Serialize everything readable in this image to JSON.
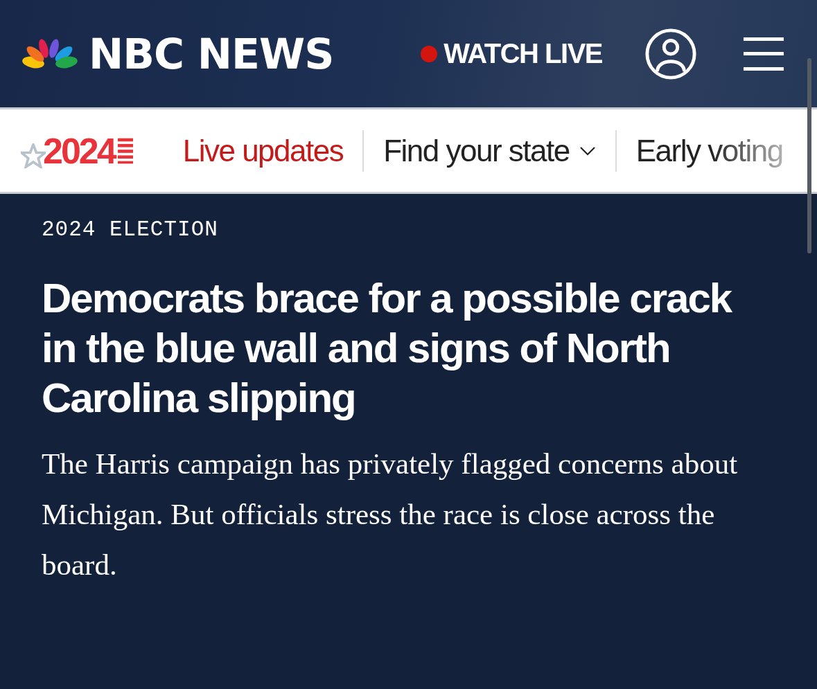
{
  "header": {
    "brand": "NBC NEWS",
    "watch_live": "WATCH LIVE"
  },
  "subnav": {
    "badge": "2024",
    "items": [
      {
        "label": "Live updates",
        "kind": "live",
        "dropdown": false
      },
      {
        "label": "Find your state",
        "kind": "link",
        "dropdown": true
      },
      {
        "label": "Early voting",
        "kind": "link",
        "dropdown": false
      }
    ]
  },
  "article": {
    "eyebrow": "2024 ELECTION",
    "headline": "Democrats brace for a possible crack in the blue wall and signs of North Carolina slipping",
    "dek": "The Harris campaign has privately flagged concerns about Michigan. But officials stress the race is close across the board."
  }
}
